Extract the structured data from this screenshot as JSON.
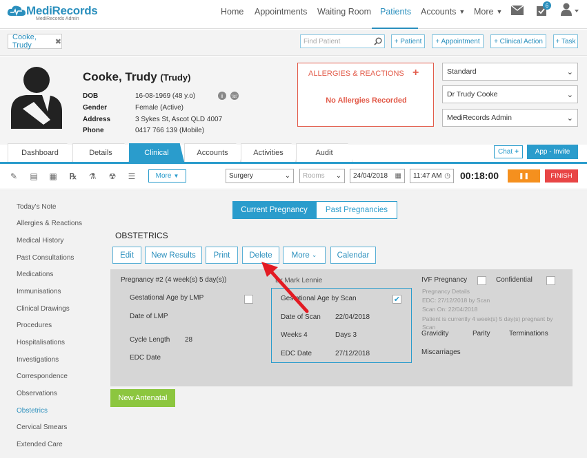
{
  "brand": {
    "name": "MediRecords",
    "subtitle": "MediRecords Admin",
    "accent": "#2a8fbd",
    "green": "#37b24d"
  },
  "nav": {
    "home": "Home",
    "appointments": "Appointments",
    "waiting_room": "Waiting Room",
    "patients": "Patients",
    "accounts": "Accounts",
    "more": "More",
    "badge": "6"
  },
  "open_patient_tab": "Cooke, Trudy",
  "search": {
    "placeholder": "Find Patient"
  },
  "quick_actions": {
    "patient": "+ Patient",
    "appointment": "+ Appointment",
    "clinical_action": "+ Clinical Action",
    "task": "+ Task"
  },
  "patient": {
    "surname_first": "Cooke, Trudy",
    "preferred": "(Trudy)",
    "fields": [
      {
        "label": "DOB",
        "value": "16-08-1969 (48 y.o)"
      },
      {
        "label": "Gender",
        "value": "Female (Active)"
      },
      {
        "label": "Address",
        "value": "3 Sykes St, Ascot QLD 4007"
      },
      {
        "label": "Phone",
        "value": "0417 766 139 (Mobile)"
      }
    ]
  },
  "allergies": {
    "title": "ALLERGIES & REACTIONS",
    "plus": "+",
    "status": "No Allergies Recorded",
    "color": "#e25b4a"
  },
  "selects": {
    "type": "Standard",
    "doctor": "Dr Trudy Cooke",
    "practice": "MediRecords Admin"
  },
  "tabs": [
    "Dashboard",
    "Details",
    "Clinical",
    "Accounts",
    "Activities",
    "Audit"
  ],
  "chat_label": "Chat",
  "app_invite_label": "App - Invite",
  "toolbar": {
    "more": "More",
    "location": "Surgery",
    "rooms": "Rooms",
    "date": "24/04/2018",
    "time": "11:47 AM",
    "timer": "00:18:00",
    "pause": "❚❚",
    "finish": "FINISH"
  },
  "side_nav": [
    "Today's Note",
    "Allergies & Reactions",
    "Medical History",
    "Past Consultations",
    "Medications",
    "Immunisations",
    "Clinical Drawings",
    "Procedures",
    "Hospitalisations",
    "Investigations",
    "Correspondence",
    "Observations",
    "Obstetrics",
    "Cervical Smears",
    "Extended Care"
  ],
  "pregnancy_toggle": {
    "current": "Current Pregnancy",
    "past": "Past Pregnancies"
  },
  "section_title": "OBSTETRICS",
  "actions": {
    "edit": "Edit",
    "new_results": "New Results",
    "print": "Print",
    "delete": "Delete",
    "more": "More",
    "calendar": "Calendar"
  },
  "panel": {
    "pregnancy_label": "Pregnancy #2 (4 week(s) 5 day(s))",
    "ga_lmp": "Gestational Age by LMP",
    "date_lmp": "Date of LMP",
    "cycle_length_label": "Cycle Length",
    "cycle_length": "28",
    "edc_date": "EDC Date",
    "clinician": "Dr Mark Lennie",
    "ga_scan": "Gestational Age by Scan",
    "date_scan_label": "Date of Scan",
    "date_scan": "22/04/2018",
    "weeks": "Weeks 4",
    "days": "Days 3",
    "edc_label": "EDC Date",
    "edc": "27/12/2018",
    "ivf": "IVF Pregnancy",
    "confidential": "Confidential",
    "details_title": "Pregnancy Details",
    "details_edc": "EDC: 27/12/2018 by Scan",
    "details_scan": "Scan On: 22/04/2018",
    "details_status": "Patient is currently 4 week(s) 5 day(s) pregnant by Scan",
    "gravidity": "Gravidity",
    "parity": "Parity",
    "terminations": "Terminations",
    "miscarriages": "Miscarriages"
  },
  "new_antenatal": "New Antenatal"
}
